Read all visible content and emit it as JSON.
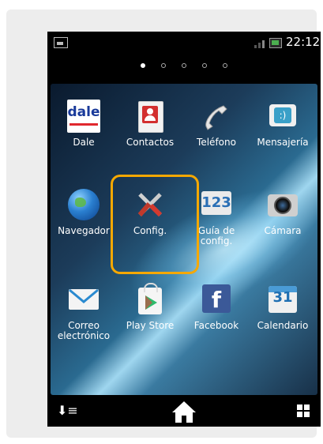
{
  "status": {
    "time": "22:12"
  },
  "pager": {
    "count": 5,
    "active": 0
  },
  "apps": [
    {
      "label": "Dale",
      "icon": "dale-icon",
      "logo_text": "dale"
    },
    {
      "label": "Contactos",
      "icon": "contacts-icon"
    },
    {
      "label": "Teléfono",
      "icon": "phone-icon"
    },
    {
      "label": "Mensajería",
      "icon": "messaging-icon"
    },
    {
      "label": "Navegador",
      "icon": "globe-icon"
    },
    {
      "label": "Config.",
      "icon": "settings-tools-icon"
    },
    {
      "label": "Guía de config.",
      "icon": "setup-guide-icon",
      "logo_text": "123"
    },
    {
      "label": "Cámara",
      "icon": "camera-icon"
    },
    {
      "label": "Correo electrónico",
      "icon": "email-icon"
    },
    {
      "label": "Play Store",
      "icon": "play-store-icon"
    },
    {
      "label": "Facebook",
      "icon": "facebook-icon",
      "logo_text": "f"
    },
    {
      "label": "Calendario",
      "icon": "calendar-icon",
      "logo_text": "31"
    }
  ],
  "colors": {
    "highlight": "#f6a800"
  },
  "navbar": {
    "left": "sort-icon",
    "center": "home-icon",
    "right": "app-grid-icon"
  }
}
